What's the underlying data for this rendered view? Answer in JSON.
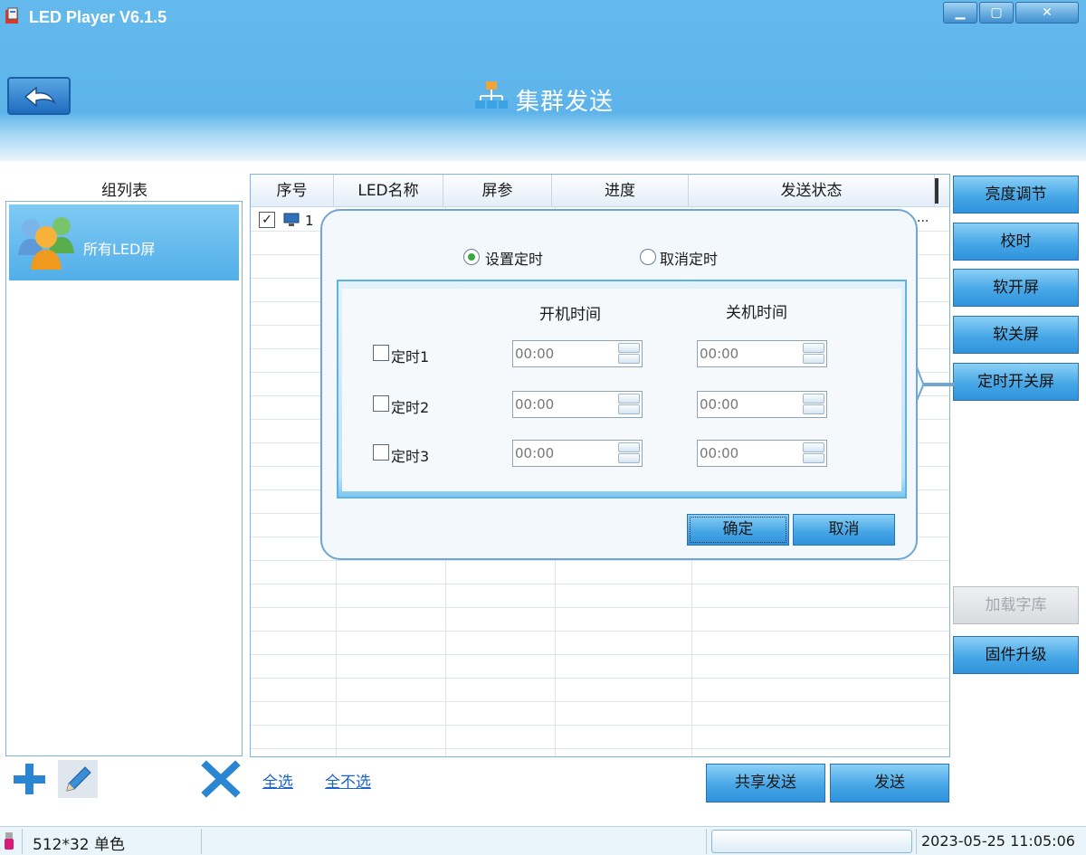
{
  "window": {
    "title": "LED Player V6.1.5",
    "controls": {
      "minimize": "▁",
      "maximize": "▢",
      "close": "✕"
    }
  },
  "header": {
    "page_title": "集群发送"
  },
  "group_panel": {
    "label": "组列表",
    "items": [
      {
        "label": "所有LED屏",
        "selected": true
      }
    ]
  },
  "table": {
    "columns": [
      "序号",
      "LED名称",
      "屏参",
      "进度",
      "发送状态"
    ],
    "rows": [
      {
        "checked": true,
        "index": "1",
        "trailing": "..."
      }
    ]
  },
  "side_buttons": [
    {
      "label": "亮度调节",
      "enabled": true
    },
    {
      "label": "校时",
      "enabled": true
    },
    {
      "label": "软开屏",
      "enabled": true
    },
    {
      "label": "软关屏",
      "enabled": true
    },
    {
      "label": "定时开关屏",
      "enabled": true,
      "active": true
    },
    {
      "label": "加载字库",
      "enabled": false
    },
    {
      "label": "固件升级",
      "enabled": true
    }
  ],
  "bottom": {
    "select_all": "全选",
    "select_none": "全不选",
    "shared_send": "共享发送",
    "send": "发送"
  },
  "popup": {
    "radio_set": "设置定时",
    "radio_cancel": "取消定时",
    "selected_radio": "set",
    "col_on": "开机时间",
    "col_off": "关机时间",
    "timers": [
      {
        "label": "定时1",
        "checked": false,
        "on_time": "00:00",
        "off_time": "00:00"
      },
      {
        "label": "定时2",
        "checked": false,
        "on_time": "00:00",
        "off_time": "00:00"
      },
      {
        "label": "定时3",
        "checked": false,
        "on_time": "00:00",
        "off_time": "00:00"
      }
    ],
    "ok": "确定",
    "cancel": "取消"
  },
  "status": {
    "resolution": "512*32 单色",
    "datetime": "2023-05-25 11:05:06"
  },
  "colors": {
    "header_blue": "#5db4ea",
    "button_blue": "#47a7e6",
    "radio_green": "#36a93f"
  },
  "icons": {
    "back": "back-arrow-icon",
    "title": "cluster-network-icon",
    "group": "users-group-icon",
    "add": "plus-icon",
    "edit": "pencil-icon",
    "delete": "cross-icon",
    "row": "monitor-icon",
    "usb": "usb-icon"
  }
}
